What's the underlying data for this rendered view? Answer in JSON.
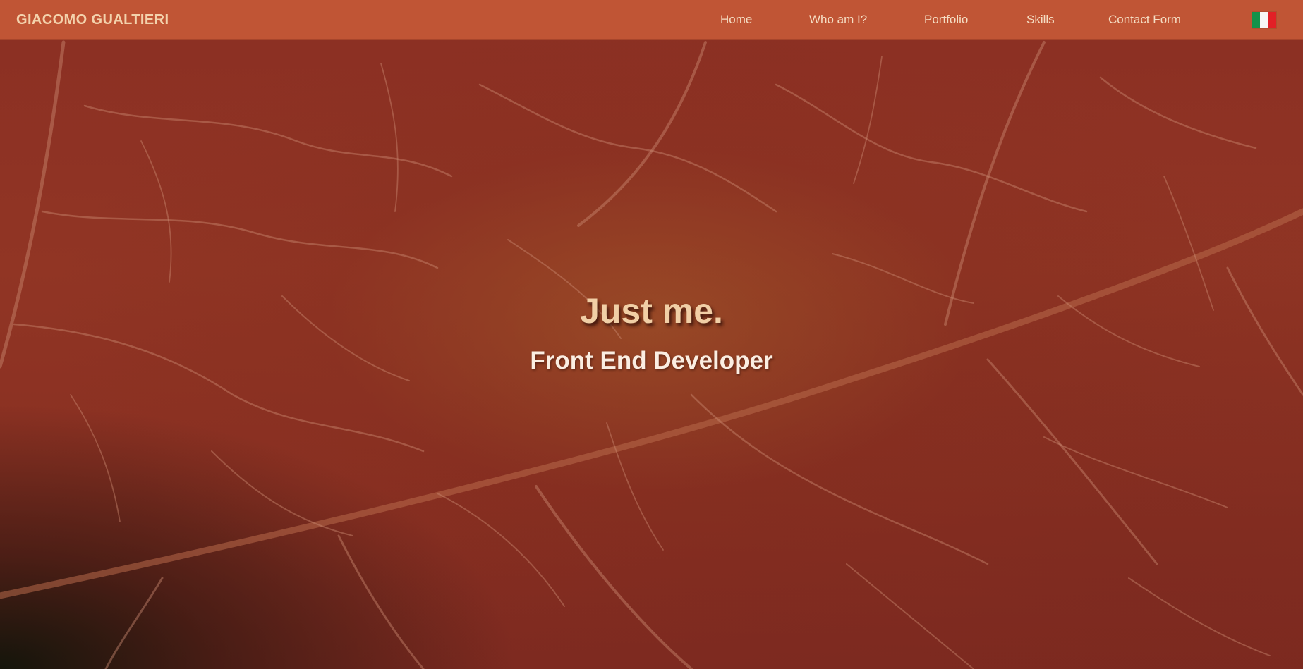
{
  "navbar": {
    "brand": "GIACOMO GUALTIERI",
    "links": [
      {
        "label": "Home"
      },
      {
        "label": "Who am I?"
      },
      {
        "label": "Portfolio"
      },
      {
        "label": "Skills"
      },
      {
        "label": "Contact Form"
      }
    ],
    "language_flag": {
      "icon": "italy-flag-icon",
      "colors": [
        "#12924a",
        "#f7f7f5",
        "#e21f26"
      ]
    }
  },
  "hero": {
    "title": "Just me.",
    "subtitle": "Front End Developer",
    "background": "leaf-veins-image"
  },
  "colors": {
    "navbar_bg": "#c45837",
    "brand_text": "#f3d2ac",
    "hero_title": "#f1cfa6",
    "hero_subtitle": "#fbeee2",
    "background_base": "#8a2f22"
  }
}
